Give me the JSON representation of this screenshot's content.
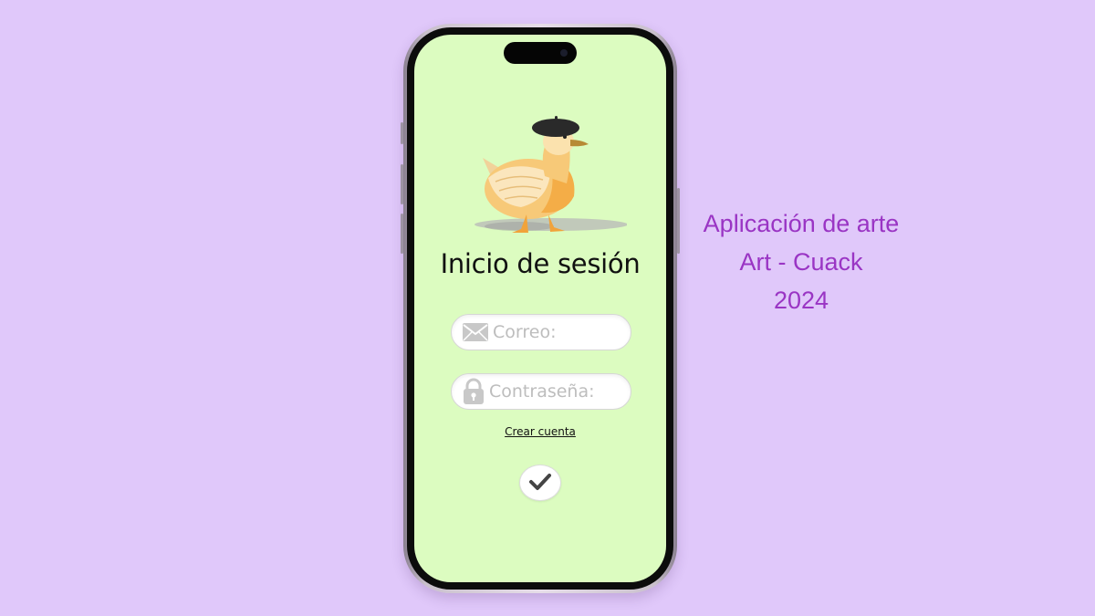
{
  "login": {
    "title": "Inicio de sesión",
    "email_placeholder": "Correo:",
    "email_value": "",
    "email_icon": "envelope-icon",
    "password_placeholder": "Contraseña:",
    "password_value": "",
    "password_icon": "lock-icon",
    "create_account_label": "Crear cuenta",
    "submit_icon": "checkmark-icon"
  },
  "caption": {
    "line1": "Aplicación de arte",
    "line2": "Art - Cuack",
    "line3": "2024"
  },
  "colors": {
    "background": "#e0c8fa",
    "screen": "#dcfcc0",
    "caption_text": "#9a35c4",
    "duck_body": "#f7c978",
    "duck_beret": "#2a2a2a"
  }
}
